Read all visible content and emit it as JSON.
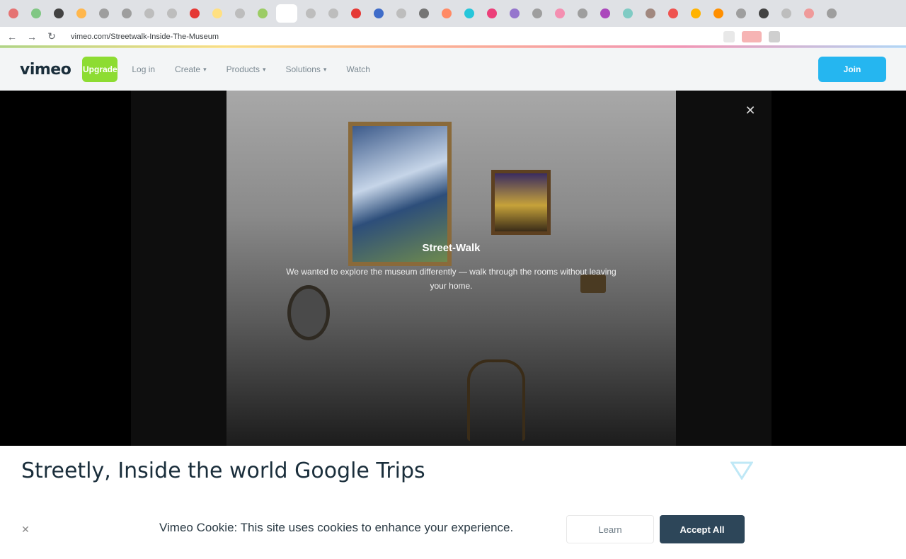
{
  "browser": {
    "tabs": [
      {
        "color": "#e57373"
      },
      {
        "color": "#81c784"
      },
      {
        "color": "#424242"
      },
      {
        "color": "#ffb74d"
      },
      {
        "color": "#9e9e9e"
      },
      {
        "color": "#9e9e9e"
      },
      {
        "color": "#bdbdbd"
      },
      {
        "color": "#bdbdbd"
      },
      {
        "color": "#e53935"
      },
      {
        "color": "#ffe082"
      },
      {
        "color": "#bdbdbd"
      },
      {
        "color": "#9ccc65"
      },
      {
        "color": "#ffffff",
        "active": true
      },
      {
        "color": "#bdbdbd"
      },
      {
        "color": "#bdbdbd"
      },
      {
        "color": "#e53935"
      },
      {
        "color": "#3f6cc9"
      },
      {
        "color": "#bdbdbd"
      },
      {
        "color": "#757575"
      },
      {
        "color": "#ff8a65"
      },
      {
        "color": "#26c6da"
      },
      {
        "color": "#ec407a"
      },
      {
        "color": "#9575cd"
      },
      {
        "color": "#9e9e9e"
      },
      {
        "color": "#f48fb1"
      },
      {
        "color": "#9e9e9e"
      },
      {
        "color": "#ab47bc"
      },
      {
        "color": "#80cbc4"
      },
      {
        "color": "#a1887f"
      },
      {
        "color": "#ef5350"
      },
      {
        "color": "#ffb300"
      },
      {
        "color": "#ff8f00"
      },
      {
        "color": "#9e9e9e"
      },
      {
        "color": "#424242"
      },
      {
        "color": "#bdbdbd"
      },
      {
        "color": "#ef9a9a"
      },
      {
        "color": "#9e9e9e"
      }
    ],
    "url": "vimeo.com/Streetwalk-Inside-The-Museum"
  },
  "header": {
    "logo": "vimeo",
    "upgrade_label": "Upgrade",
    "nav": [
      "Log in",
      "Create",
      "Products",
      "Solutions",
      "Watch"
    ],
    "join_label": "Join"
  },
  "player": {
    "overlay_title": "Street-Walk",
    "overlay_sub": "We wanted to explore the museum differently — walk through the rooms without leaving your home.",
    "close_icon": "close-icon"
  },
  "video": {
    "title": "Streetly, Inside the world Google Trips"
  },
  "cookie": {
    "text": "Vimeo Cookie: This site uses cookies to enhance your experience.",
    "learn_label": "Learn",
    "accept_label": "Accept All"
  }
}
